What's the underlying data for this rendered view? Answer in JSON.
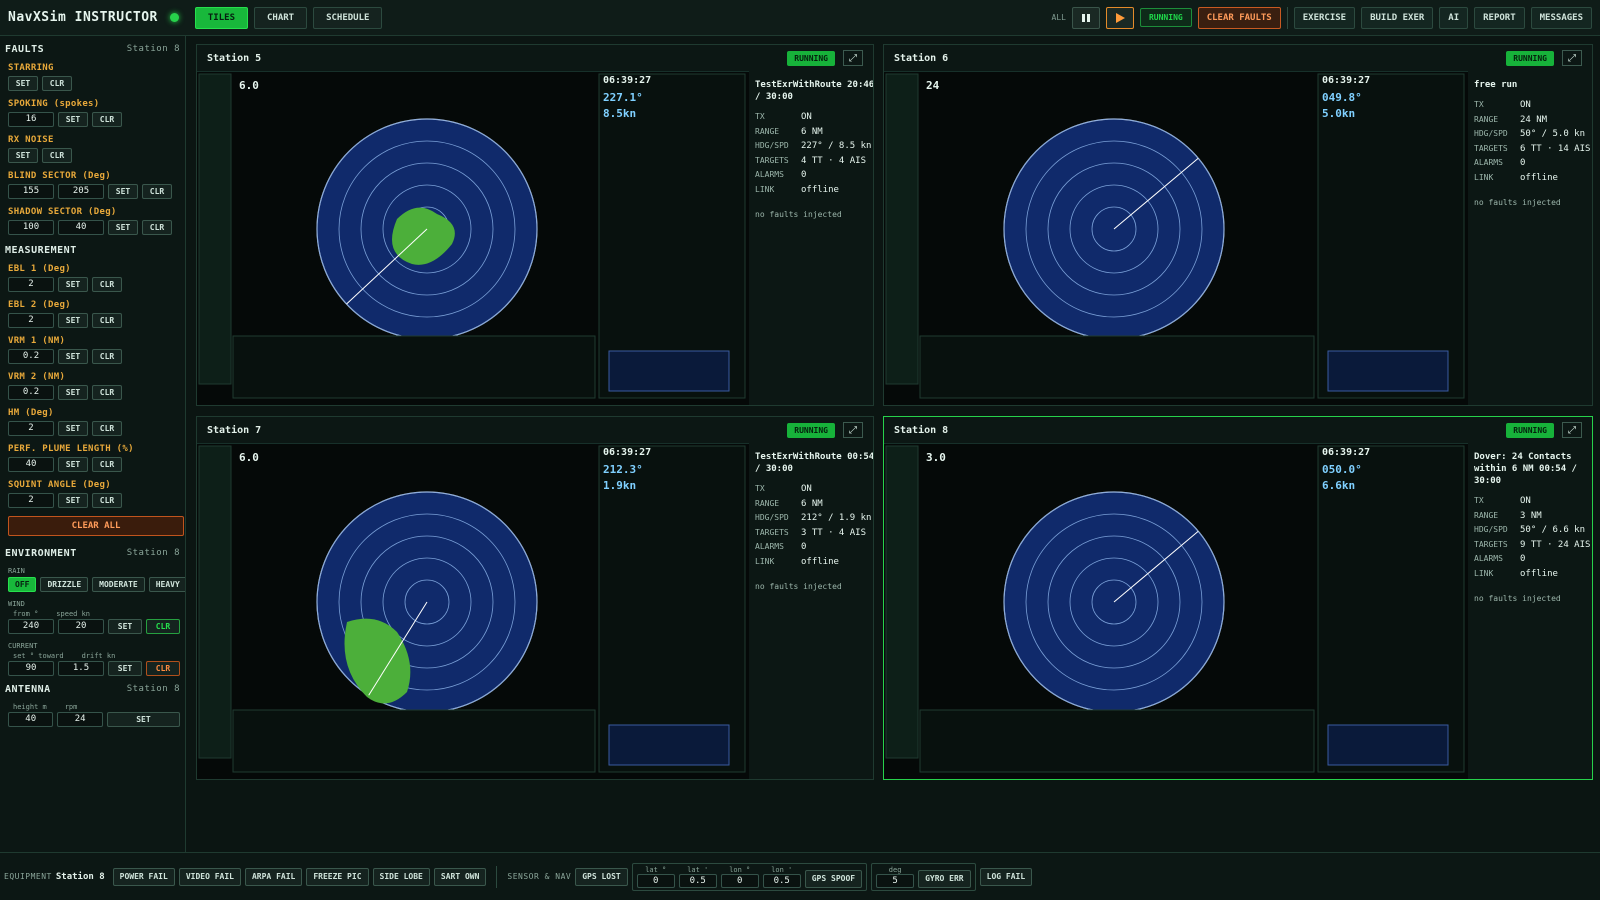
{
  "app": {
    "title": "NavXSim INSTRUCTOR"
  },
  "top_tabs": [
    "TILES",
    "CHART",
    "SCHEDULE"
  ],
  "top": {
    "all_label": "ALL",
    "status": "RUNNING",
    "clear_faults": "CLEAR FAULTS",
    "actions": [
      "EXERCISE",
      "BUILD EXER",
      "AI",
      "REPORT",
      "MESSAGES"
    ]
  },
  "faults": {
    "title": "FAULTS",
    "station": "Station 8",
    "starring": {
      "title": "STARRING",
      "set": "SET",
      "clr": "CLR"
    },
    "spoking": {
      "title": "SPOKING (spokes)",
      "value": "16",
      "set": "SET",
      "clr": "CLR"
    },
    "rx_noise": {
      "title": "RX NOISE",
      "set": "SET",
      "clr": "CLR"
    },
    "blind": {
      "title": "BLIND SECTOR (Deg)",
      "v1": "155",
      "v2": "205",
      "set": "SET",
      "clr": "CLR"
    },
    "shadow": {
      "title": "SHADOW SECTOR (Deg)",
      "v1": "100",
      "v2": "40",
      "set": "SET",
      "clr": "CLR"
    }
  },
  "measurement": {
    "title": "MEASUREMENT",
    "items": [
      {
        "title": "EBL 1 (Deg)",
        "value": "2",
        "set": "SET",
        "clr": "CLR"
      },
      {
        "title": "EBL 2 (Deg)",
        "value": "2",
        "set": "SET",
        "clr": "CLR"
      },
      {
        "title": "VRM 1 (NM)",
        "value": "0.2",
        "set": "SET",
        "clr": "CLR"
      },
      {
        "title": "VRM 2 (NM)",
        "value": "0.2",
        "set": "SET",
        "clr": "CLR"
      },
      {
        "title": "HM (Deg)",
        "value": "2",
        "set": "SET",
        "clr": "CLR"
      },
      {
        "title": "PERF. PLUME LENGTH (%)",
        "value": "40",
        "set": "SET",
        "clr": "CLR"
      },
      {
        "title": "SQUINT ANGLE (Deg)",
        "value": "2",
        "set": "SET",
        "clr": "CLR"
      }
    ],
    "clear_all": "CLEAR ALL"
  },
  "environment": {
    "title": "ENVIRONMENT",
    "station": "Station 8",
    "rain_label": "RAIN",
    "rain_opts": [
      "OFF",
      "DRIZZLE",
      "MODERATE",
      "HEAVY"
    ],
    "wind_label": "WIND",
    "wind_from_lbl": "from °",
    "wind_speed_lbl": "speed kn",
    "wind_from": "240",
    "wind_speed": "20",
    "current_label": "CURRENT",
    "cur_set_lbl": "set ° toward",
    "cur_drift_lbl": "drift kn",
    "cur_set": "90",
    "cur_drift": "1.5",
    "set": "SET",
    "clr": "CLR"
  },
  "antenna": {
    "title": "ANTENNA",
    "station": "Station 8",
    "h_lbl": "height m",
    "rpm_lbl": "rpm",
    "height": "40",
    "rpm": "24",
    "set": "SET"
  },
  "stations": [
    {
      "name": "Station 5",
      "status": "RUNNING",
      "route": "TestExrWithRoute 20:46 / 30:00",
      "kv": [
        [
          "TX",
          "ON"
        ],
        [
          "RANGE",
          "6 NM"
        ],
        [
          "HDG/SPD",
          "227° / 8.5 kn"
        ],
        [
          "TARGETS",
          "4 TT · 4 AIS"
        ],
        [
          "ALARMS",
          "0"
        ],
        [
          "LINK",
          "offline"
        ]
      ],
      "note": "no faults injected",
      "hdg": "227.1°",
      "sog": "8.5kn",
      "range": "6.0",
      "time": "06:39:27"
    },
    {
      "name": "Station 6",
      "status": "RUNNING",
      "route": "free run",
      "kv": [
        [
          "TX",
          "ON"
        ],
        [
          "RANGE",
          "24 NM"
        ],
        [
          "HDG/SPD",
          "50° / 5.0 kn"
        ],
        [
          "TARGETS",
          "6 TT · 14 AIS"
        ],
        [
          "ALARMS",
          "0"
        ],
        [
          "LINK",
          "offline"
        ]
      ],
      "note": "no faults injected",
      "hdg": "049.8°",
      "sog": "5.0kn",
      "range": "24",
      "time": "06:39:27"
    },
    {
      "name": "Station 7",
      "status": "RUNNING",
      "route": "TestExrWithRoute 00:54 / 30:00",
      "kv": [
        [
          "TX",
          "ON"
        ],
        [
          "RANGE",
          "6 NM"
        ],
        [
          "HDG/SPD",
          "212° / 1.9 kn"
        ],
        [
          "TARGETS",
          "3 TT · 4 AIS"
        ],
        [
          "ALARMS",
          "0"
        ],
        [
          "LINK",
          "offline"
        ]
      ],
      "note": "no faults injected",
      "hdg": "212.3°",
      "sog": "1.9kn",
      "range": "6.0",
      "time": "06:39:27"
    },
    {
      "name": "Station 8",
      "status": "RUNNING",
      "route": "Dover: 24 Contacts within 6 NM 00:54 / 30:00",
      "kv": [
        [
          "TX",
          "ON"
        ],
        [
          "RANGE",
          "3 NM"
        ],
        [
          "HDG/SPD",
          "50° / 6.6 kn"
        ],
        [
          "TARGETS",
          "9 TT · 24 AIS"
        ],
        [
          "ALARMS",
          "0"
        ],
        [
          "LINK",
          "offline"
        ]
      ],
      "note": "no faults injected",
      "hdg": "050.0°",
      "sog": "6.6kn",
      "range": "3.0",
      "time": "06:39:27"
    }
  ],
  "bottom": {
    "equipment_lbl": "EQUIPMENT",
    "station": "Station 8",
    "equip": [
      "POWER FAIL",
      "VIDEO FAIL",
      "ARPA FAIL",
      "FREEZE PIC",
      "SIDE LOBE",
      "SART OWN"
    ],
    "sensor_lbl": "SENSOR & NAV",
    "gps_lost": "GPS LOST",
    "gps_cells": [
      {
        "t": "lat °",
        "v": "0"
      },
      {
        "t": "lat '",
        "v": "0.5"
      },
      {
        "t": "lon °",
        "v": "0"
      },
      {
        "t": "lon '",
        "v": "0.5"
      }
    ],
    "gps_spoof": "GPS SPOOF",
    "gyro_cell": {
      "t": "deg",
      "v": "5"
    },
    "gyro_err": "GYRO ERR",
    "log_fail": "LOG FAIL"
  },
  "colors": {
    "accent": "#18b83b",
    "warn": "#e8a93a",
    "danger": "#c1541d",
    "ppi_bg": "#102a6b",
    "land": "#4caf3a"
  }
}
